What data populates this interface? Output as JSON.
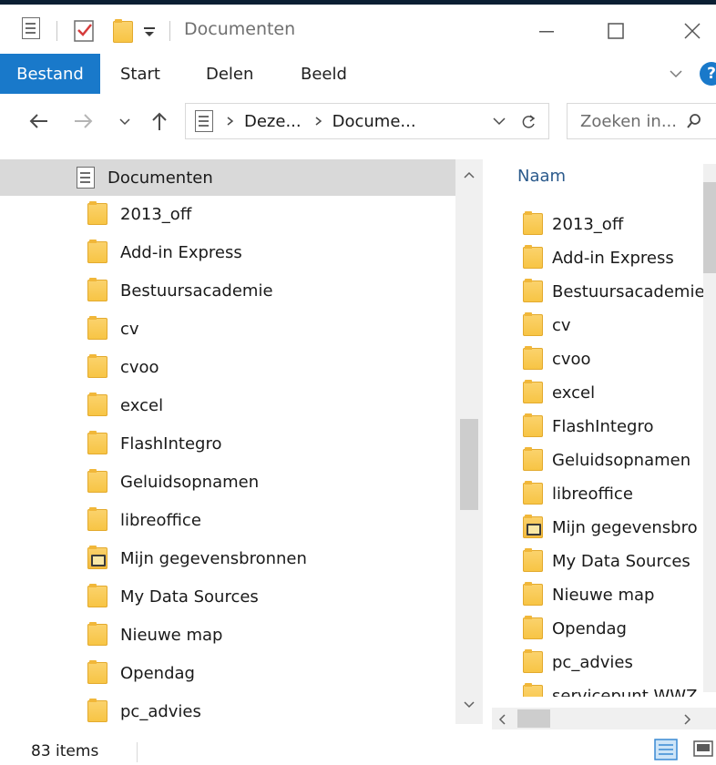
{
  "window": {
    "title": "Documenten",
    "controls": {
      "minimize_icon": "minimize-icon",
      "maximize_icon": "maximize-icon",
      "close_icon": "close-icon"
    }
  },
  "ribbon": {
    "tabs": [
      "Bestand",
      "Start",
      "Delen",
      "Beeld"
    ],
    "active_tab": "Bestand",
    "help_label": "?"
  },
  "address": {
    "crumbs": [
      "Deze...",
      "Docume..."
    ],
    "search_placeholder": "Zoeken in..."
  },
  "navpane": {
    "root": "Documenten",
    "items": [
      {
        "label": "2013_off"
      },
      {
        "label": "Add-in Express"
      },
      {
        "label": "Bestuursacademie"
      },
      {
        "label": "cv"
      },
      {
        "label": "cvoo"
      },
      {
        "label": "excel"
      },
      {
        "label": "FlashIntegro"
      },
      {
        "label": "Geluidsopnamen"
      },
      {
        "label": "libreoffice"
      },
      {
        "label": "Mijn gegevensbronnen",
        "special": true
      },
      {
        "label": "My Data Sources"
      },
      {
        "label": "Nieuwe map"
      },
      {
        "label": "Opendag"
      },
      {
        "label": "pc_advies"
      }
    ]
  },
  "content": {
    "column_header": "Naam",
    "items": [
      {
        "label": "2013_off"
      },
      {
        "label": "Add-in Express"
      },
      {
        "label": "Bestuursacademie"
      },
      {
        "label": "cv"
      },
      {
        "label": "cvoo"
      },
      {
        "label": "excel"
      },
      {
        "label": "FlashIntegro"
      },
      {
        "label": "Geluidsopnamen"
      },
      {
        "label": "libreoffice"
      },
      {
        "label": "Mijn gegevensbro",
        "special": true
      },
      {
        "label": "My Data Sources"
      },
      {
        "label": "Nieuwe map"
      },
      {
        "label": "Opendag"
      },
      {
        "label": "pc_advies"
      },
      {
        "label": "servicepunt WWZ"
      }
    ]
  },
  "status": {
    "item_count": "83 items"
  },
  "colors": {
    "accent": "#1979ca",
    "selection": "#d9d9d9",
    "folder": "#f7c443"
  }
}
